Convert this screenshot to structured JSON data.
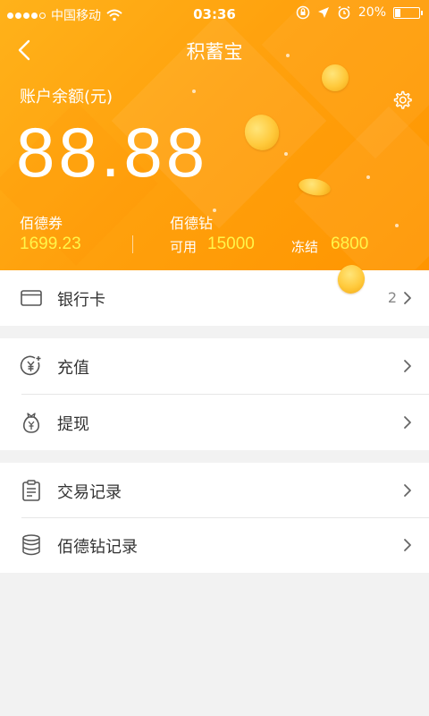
{
  "status_bar": {
    "carrier": "中国移动",
    "time": "03:36",
    "battery": "20%",
    "battery_level": 0.2,
    "icons": [
      "signal-dots-icon",
      "wifi-icon",
      "orientation-lock-icon",
      "location-icon",
      "alarm-icon",
      "battery-icon"
    ]
  },
  "nav": {
    "title": "积蓄宝",
    "back_icon": "back-arrow-icon"
  },
  "balance": {
    "label": "账户余额(元)",
    "amount": "88.88",
    "settings_icon": "gear-icon"
  },
  "sub": {
    "coupon_label": "佰德券",
    "coupon_value": "1699.23",
    "diamond_label": "佰德钻",
    "available_label": "可用",
    "available_value": "15000",
    "frozen_label": "冻结",
    "frozen_value": "6800"
  },
  "menu": {
    "bank_card": {
      "label": "银行卡",
      "count": "2",
      "icon": "card-icon"
    },
    "recharge": {
      "label": "充值",
      "icon": "yuan-plus-icon"
    },
    "withdraw": {
      "label": "提现",
      "icon": "money-bag-icon"
    },
    "transactions": {
      "label": "交易记录",
      "icon": "clipboard-icon"
    },
    "diamond_records": {
      "label": "佰德钻记录",
      "icon": "coin-stack-icon"
    }
  },
  "colors": {
    "hero_orange": "#ffa10d",
    "accent_yellow": "#fff54a",
    "background": "#f2f2f2"
  }
}
